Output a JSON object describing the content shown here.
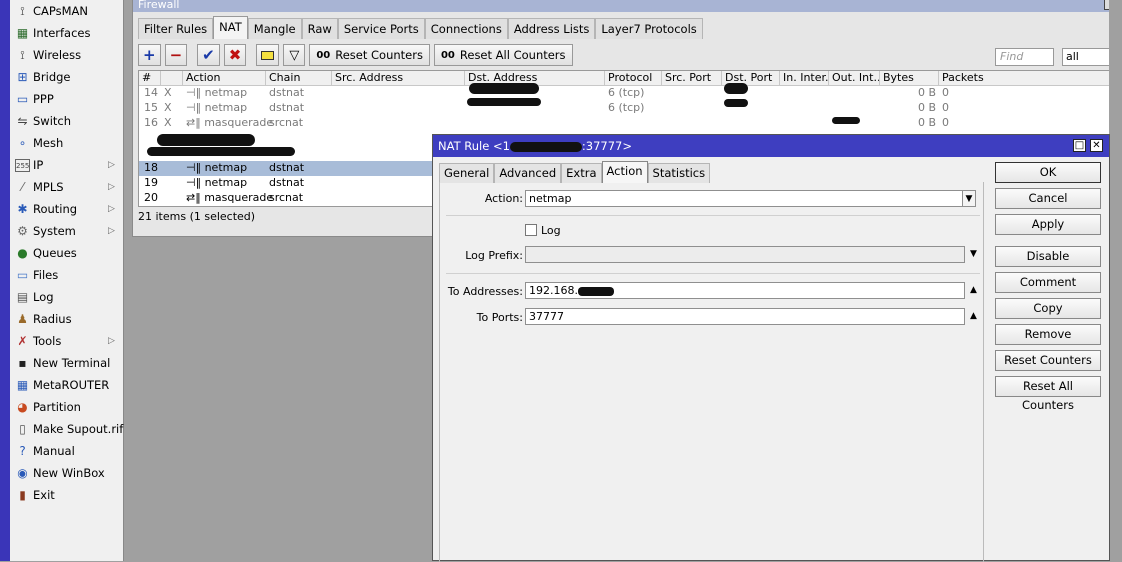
{
  "sidebar": {
    "items": [
      {
        "label": "CAPsMAN",
        "icon": "capsman-icon",
        "glyph": "⟟",
        "arrow": false
      },
      {
        "label": "Interfaces",
        "icon": "interfaces-icon",
        "glyph": "▦",
        "arrow": false
      },
      {
        "label": "Wireless",
        "icon": "wireless-icon",
        "glyph": "⟟",
        "arrow": false
      },
      {
        "label": "Bridge",
        "icon": "bridge-icon",
        "glyph": "⊞",
        "arrow": false
      },
      {
        "label": "PPP",
        "icon": "ppp-icon",
        "glyph": "▭",
        "arrow": false
      },
      {
        "label": "Switch",
        "icon": "switch-icon",
        "glyph": "⇋",
        "arrow": false
      },
      {
        "label": "Mesh",
        "icon": "mesh-icon",
        "glyph": "∘",
        "arrow": false
      },
      {
        "label": "IP",
        "icon": "ip-icon",
        "glyph": "255",
        "arrow": true
      },
      {
        "label": "MPLS",
        "icon": "mpls-icon",
        "glyph": "⁄",
        "arrow": true
      },
      {
        "label": "Routing",
        "icon": "routing-icon",
        "glyph": "✱",
        "arrow": true
      },
      {
        "label": "System",
        "icon": "system-icon",
        "glyph": "⚙",
        "arrow": true
      },
      {
        "label": "Queues",
        "icon": "queues-icon",
        "glyph": "●",
        "arrow": false
      },
      {
        "label": "Files",
        "icon": "files-icon",
        "glyph": "▭",
        "arrow": false
      },
      {
        "label": "Log",
        "icon": "log-icon",
        "glyph": "▤",
        "arrow": false
      },
      {
        "label": "Radius",
        "icon": "radius-icon",
        "glyph": "♟",
        "arrow": false
      },
      {
        "label": "Tools",
        "icon": "tools-icon",
        "glyph": "✗",
        "arrow": true
      },
      {
        "label": "New Terminal",
        "icon": "terminal-icon",
        "glyph": "▪",
        "arrow": false
      },
      {
        "label": "MetaROUTER",
        "icon": "metarouter-icon",
        "glyph": "▦",
        "arrow": false
      },
      {
        "label": "Partition",
        "icon": "partition-icon",
        "glyph": "◕",
        "arrow": false
      },
      {
        "label": "Make Supout.rif",
        "icon": "supout-icon",
        "glyph": "▯",
        "arrow": false
      },
      {
        "label": "Manual",
        "icon": "manual-icon",
        "glyph": "?",
        "arrow": false
      },
      {
        "label": "New WinBox",
        "icon": "winbox-icon",
        "glyph": "◉",
        "arrow": false
      },
      {
        "label": "Exit",
        "icon": "exit-icon",
        "glyph": "▮",
        "arrow": false
      }
    ]
  },
  "firewall": {
    "title": "Firewall",
    "tabs": [
      "Filter Rules",
      "NAT",
      "Mangle",
      "Raw",
      "Service Ports",
      "Connections",
      "Address Lists",
      "Layer7 Protocols"
    ],
    "active_tab": 1,
    "toolbar": {
      "reset_counters": "Reset Counters",
      "reset_all_counters": "Reset All Counters",
      "counter_prefix": "00"
    },
    "find_placeholder": "Find",
    "filter_value": "all",
    "columns": [
      "#",
      "Action",
      "Chain",
      "Src. Address",
      "Dst. Address",
      "Protocol",
      "Src. Port",
      "Dst. Port",
      "In. Inter...",
      "Out. Int...",
      "Bytes",
      "Packets"
    ],
    "rows": [
      {
        "num": "14",
        "flag": "X",
        "action": "netmap",
        "chain": "dstnat",
        "protocol": "6 (tcp)",
        "bytes": "0 B",
        "packets": "0",
        "disabled": true,
        "selected": false
      },
      {
        "num": "15",
        "flag": "X",
        "action": "netmap",
        "chain": "dstnat",
        "protocol": "6 (tcp)",
        "bytes": "0 B",
        "packets": "0",
        "disabled": true,
        "selected": false
      },
      {
        "num": "16",
        "flag": "X",
        "action": "masquerade",
        "chain": "srcnat",
        "protocol": "",
        "bytes": "0 B",
        "packets": "0",
        "disabled": true,
        "selected": false
      },
      {
        "num": "18",
        "flag": "",
        "action": "netmap",
        "chain": "dstnat",
        "protocol": "",
        "bytes": "",
        "packets": "",
        "disabled": false,
        "selected": true
      },
      {
        "num": "19",
        "flag": "",
        "action": "netmap",
        "chain": "dstnat",
        "protocol": "",
        "bytes": "",
        "packets": "",
        "disabled": false,
        "selected": false
      },
      {
        "num": "20",
        "flag": "",
        "action": "masquerade",
        "chain": "srcnat",
        "protocol": "",
        "bytes": "",
        "packets": "",
        "disabled": false,
        "selected": false
      }
    ],
    "status": "21 items (1 selected)"
  },
  "dialog": {
    "title_prefix": "NAT Rule <1",
    "title_suffix": ":37777>",
    "tabs": [
      "General",
      "Advanced",
      "Extra",
      "Action",
      "Statistics"
    ],
    "active_tab": 3,
    "action_label": "Action:",
    "action_value": "netmap",
    "log_label": "Log",
    "log_prefix_label": "Log Prefix:",
    "to_addresses_label": "To Addresses:",
    "to_addresses_value": "192.168.",
    "to_ports_label": "To Ports:",
    "to_ports_value": "37777",
    "buttons": [
      "OK",
      "Cancel",
      "Apply",
      "Disable",
      "Comment",
      "Copy",
      "Remove",
      "Reset Counters",
      "Reset All Counters"
    ]
  }
}
